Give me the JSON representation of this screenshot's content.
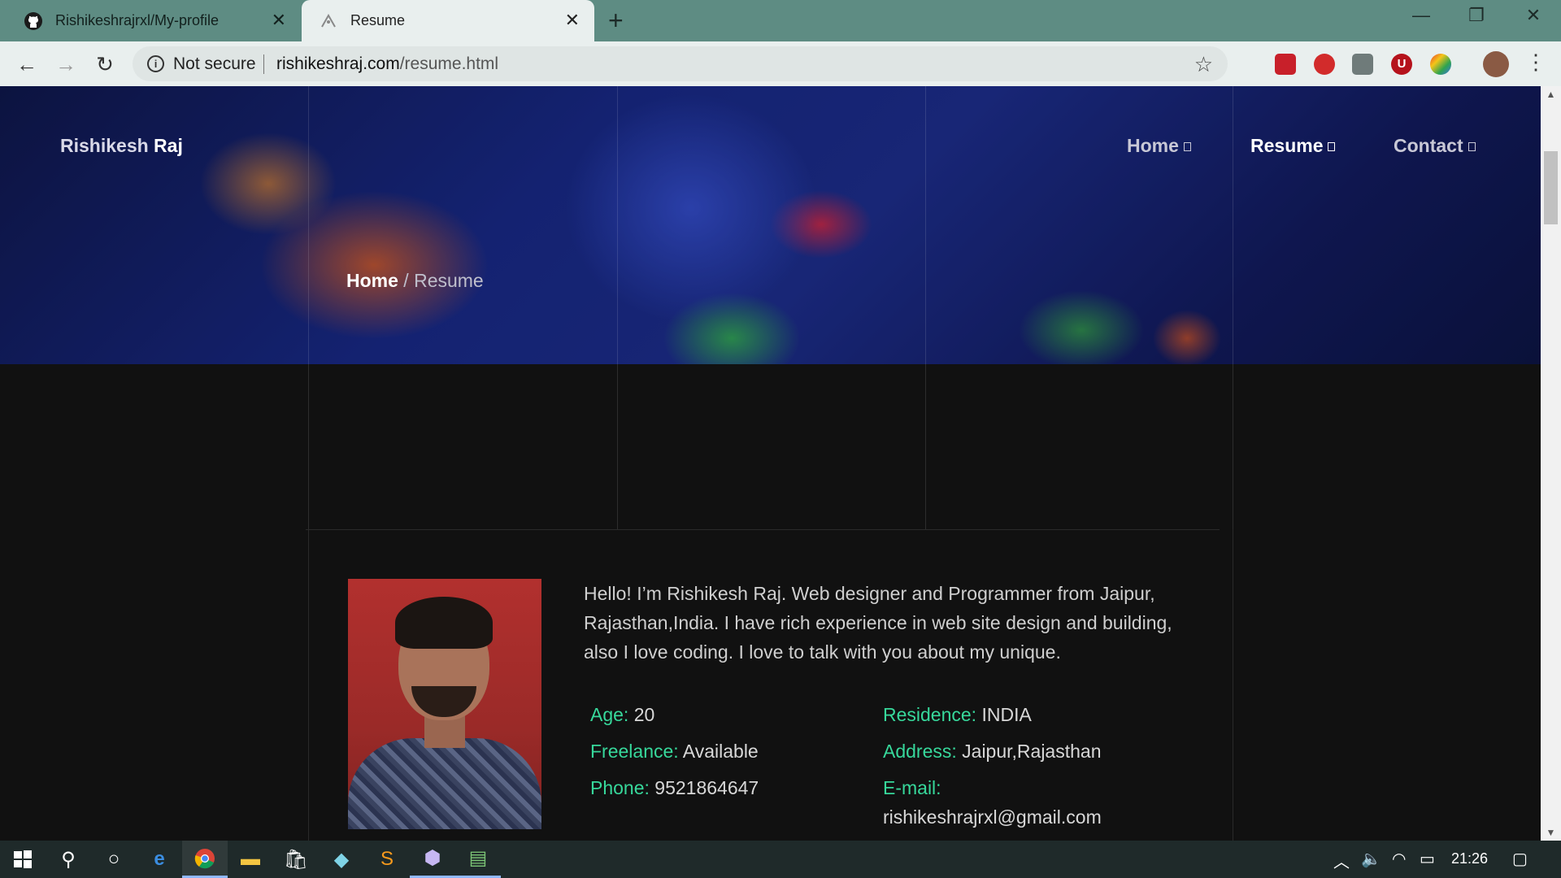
{
  "browser": {
    "tabs": [
      {
        "title": "Rishikeshrajrxl/My-profile",
        "icon": "github-icon",
        "active": false
      },
      {
        "title": "Resume",
        "icon": "site-favicon-icon",
        "active": true
      }
    ],
    "new_tab_icon": "plus-icon",
    "security_label": "Not secure",
    "url_domain": "rishikeshraj.com",
    "url_path": "/resume.html"
  },
  "site": {
    "logo_first": "Rishikesh",
    "logo_last": "Raj",
    "nav": [
      {
        "label": "Home",
        "active": false
      },
      {
        "label": "Resume",
        "active": true
      },
      {
        "label": "Contact",
        "active": false
      }
    ],
    "breadcrumb": {
      "home": "Home",
      "separator": "/",
      "current": "Resume"
    }
  },
  "profile": {
    "bio": "Hello! I’m Rishikesh Raj. Web designer and Programmer from Jaipur, Rajasthan,India. I have rich experience in web site design and building, also I love coding. I love to talk with you about my unique.",
    "info": {
      "age_label": "Age:",
      "age": "20",
      "residence_label": "Residence:",
      "residence": "INDIA",
      "freelance_label": "Freelance:",
      "freelance": "Available",
      "address_label": "Address:",
      "address": "Jaipur,Rajasthan",
      "phone_label": "Phone:",
      "phone": "9521864647",
      "email_label": "E-mail:",
      "email": "rishikeshrajrxl@gmail.com"
    },
    "accent_color": "#37d89b"
  },
  "taskbar": {
    "clock": "21:26"
  }
}
